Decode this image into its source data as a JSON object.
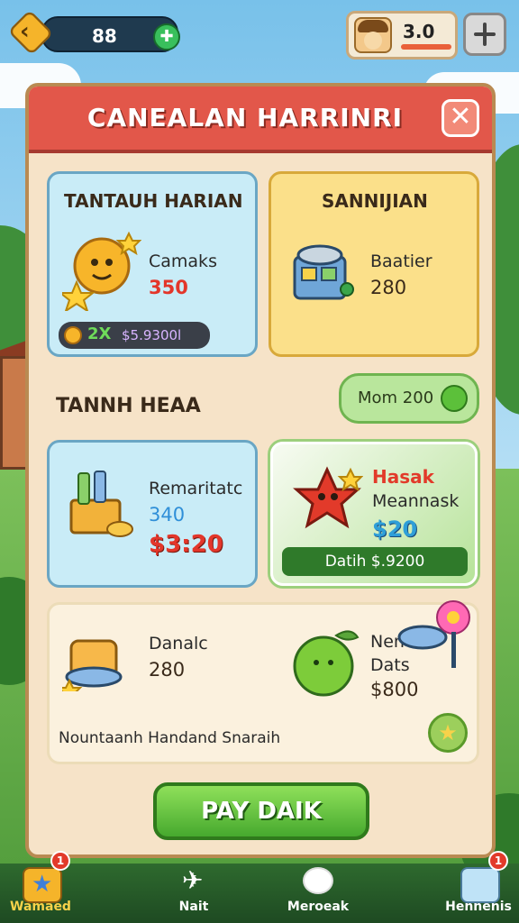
{
  "hud": {
    "coins": "88",
    "plus_icon": "plus-icon",
    "level_text": "3.0"
  },
  "panel": {
    "title": "CANEALAN HARRINRI"
  },
  "cards": {
    "daily": {
      "title": "TANTAUH HARIAN",
      "item_name": "Camaks",
      "item_value": "350",
      "pill_amount": "2X",
      "pill_price": "$5.9300l"
    },
    "special": {
      "title": "SANNIJIAN",
      "item_name": "Baatier",
      "item_value": "280"
    }
  },
  "section": {
    "title": "TANNH HEAA",
    "more_button": "Mom 200"
  },
  "offers": {
    "left": {
      "item_name": "Remaritatc",
      "item_value": "340",
      "price": "$3:20"
    },
    "right": {
      "label": "Hasak",
      "item_name": "Meannask",
      "price": "$20",
      "button": "Datih $.9200"
    }
  },
  "bundle": {
    "item1_name": "Danalc",
    "item1_value": "280",
    "item2_name": "Nen",
    "item2_sub": "Dats",
    "item2_price": "$800",
    "footer": "Nountaanh Handand Snaraih"
  },
  "pay_button": "PAY DAIK",
  "nav": [
    {
      "label": "Wamaed",
      "badge": "1"
    },
    {
      "label": "Nait",
      "badge": ""
    },
    {
      "label": "Meroeak",
      "badge": ""
    },
    {
      "label": "Hennenis",
      "badge": "1"
    }
  ],
  "colors": {
    "header_red": "#e2574a",
    "accent_green": "#46a92e",
    "price_red": "#e3362a"
  }
}
